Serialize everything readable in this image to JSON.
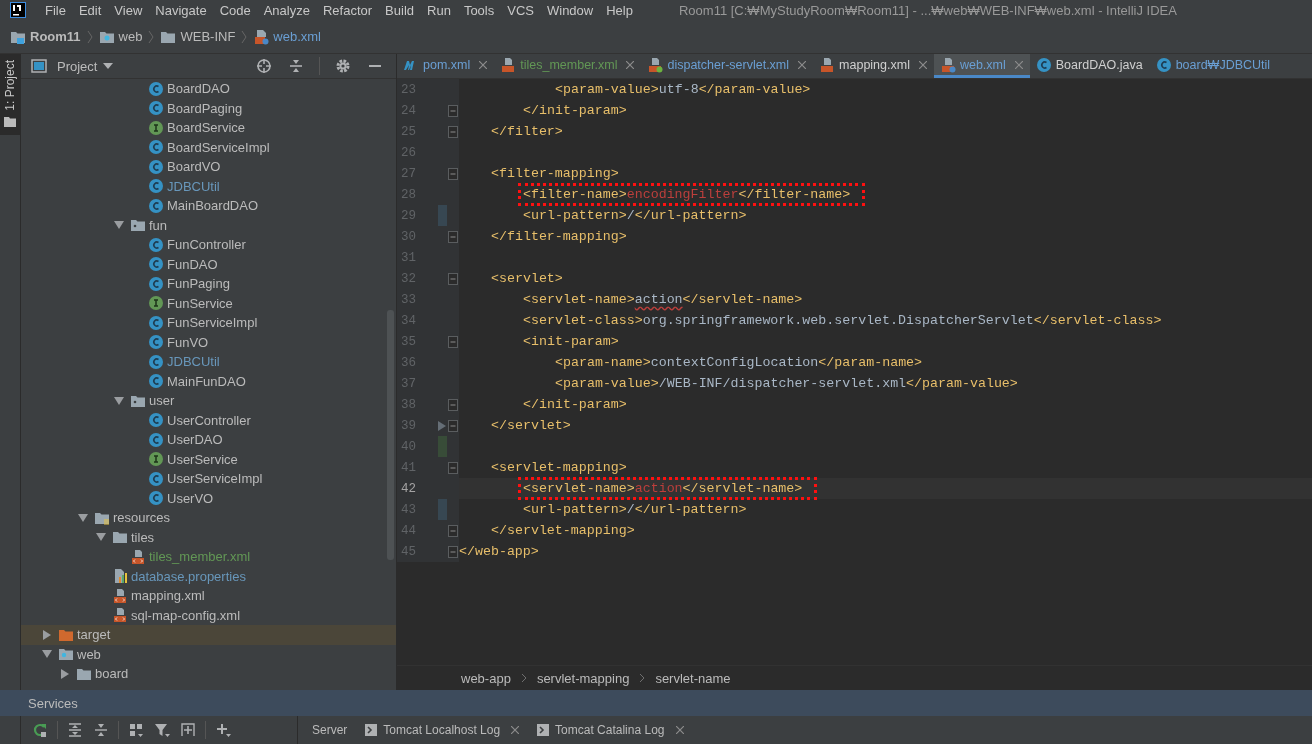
{
  "menu_bar": {
    "items": [
      "File",
      "Edit",
      "View",
      "Navigate",
      "Code",
      "Analyze",
      "Refactor",
      "Build",
      "Run",
      "Tools",
      "VCS",
      "Window",
      "Help"
    ],
    "title": "Room11 [C:₩MyStudyRoom₩Room11] - ...₩web₩WEB-INF₩web.xml - IntelliJ IDEA"
  },
  "navigation_bar": [
    {
      "label": "Room11",
      "kind": "project"
    },
    {
      "label": "web",
      "kind": "web"
    },
    {
      "label": "WEB-INF",
      "kind": "folder"
    },
    {
      "label": "web.xml",
      "kind": "webxml"
    }
  ],
  "tool_stripe": {
    "label": "1: Project",
    "selected": true
  },
  "project_panel": {
    "title": "Project",
    "tree": [
      {
        "children": [
          {
            "children": [
              {
                "children": [
                  {
                    "children": [
                      {
                        "children": [
                          {
                            "label": "BoardDAO",
                            "kind": "class",
                            "color": "#bbbbbb",
                            "selected": false
                          },
                          {
                            "label": "BoardPaging",
                            "kind": "class",
                            "color": "#bbbbbb",
                            "selected": false
                          },
                          {
                            "label": "BoardService",
                            "kind": "interface",
                            "color": "#bbbbbb",
                            "selected": false
                          },
                          {
                            "label": "BoardServiceImpl",
                            "kind": "class",
                            "color": "#bbbbbb",
                            "selected": false
                          },
                          {
                            "label": "BoardVO",
                            "kind": "class",
                            "color": "#bbbbbb",
                            "selected": false
                          },
                          {
                            "label": "JDBCUtil",
                            "kind": "class",
                            "color": "#6897bb",
                            "selected": false
                          },
                          {
                            "label": "MainBoardDAO",
                            "kind": "class",
                            "color": "#bbbbbb",
                            "selected": false
                          }
                        ]
                      },
                      {
                        "label": "fun",
                        "kind": "package",
                        "color": "#bbbbbb",
                        "selected": false,
                        "expanded": true,
                        "children": [
                          {
                            "label": "FunController",
                            "kind": "class",
                            "color": "#bbbbbb",
                            "selected": false
                          },
                          {
                            "label": "FunDAO",
                            "kind": "class",
                            "color": "#bbbbbb",
                            "selected": false
                          },
                          {
                            "label": "FunPaging",
                            "kind": "class",
                            "color": "#bbbbbb",
                            "selected": false
                          },
                          {
                            "label": "FunService",
                            "kind": "interface",
                            "color": "#bbbbbb",
                            "selected": false
                          },
                          {
                            "label": "FunServiceImpl",
                            "kind": "class",
                            "color": "#bbbbbb",
                            "selected": false
                          },
                          {
                            "label": "FunVO",
                            "kind": "class",
                            "color": "#bbbbbb",
                            "selected": false
                          },
                          {
                            "label": "JDBCUtil",
                            "kind": "class",
                            "color": "#6897bb",
                            "selected": false
                          },
                          {
                            "label": "MainFunDAO",
                            "kind": "class",
                            "color": "#bbbbbb",
                            "selected": false
                          }
                        ]
                      },
                      {
                        "label": "user",
                        "kind": "package",
                        "color": "#bbbbbb",
                        "selected": false,
                        "expanded": true,
                        "children": [
                          {
                            "label": "UserController",
                            "kind": "class",
                            "color": "#bbbbbb",
                            "selected": false
                          },
                          {
                            "label": "UserDAO",
                            "kind": "class",
                            "color": "#bbbbbb",
                            "selected": false
                          },
                          {
                            "label": "UserService",
                            "kind": "interface",
                            "color": "#bbbbbb",
                            "selected": false
                          },
                          {
                            "label": "UserServiceImpl",
                            "kind": "class",
                            "color": "#bbbbbb",
                            "selected": false
                          },
                          {
                            "label": "UserVO",
                            "kind": "class",
                            "color": "#bbbbbb",
                            "selected": false
                          }
                        ]
                      }
                    ]
                  }
                ]
              },
              {
                "label": "resources",
                "kind": "resources",
                "color": "#bbbbbb",
                "selected": false,
                "expanded": true,
                "children": [
                  {
                    "label": "tiles",
                    "kind": "folder",
                    "color": "#bbbbbb",
                    "selected": false,
                    "expanded": true,
                    "children": [
                      {
                        "label": "tiles_member.xml",
                        "kind": "xml",
                        "color": "#629755",
                        "selected": false
                      }
                    ]
                  },
                  {
                    "label": "database.properties",
                    "kind": "properties",
                    "color": "#6897bb",
                    "selected": false
                  },
                  {
                    "label": "mapping.xml",
                    "kind": "xml",
                    "color": "#bbbbbb",
                    "selected": false
                  },
                  {
                    "label": "sql-map-config.xml",
                    "kind": "xml",
                    "color": "#bbbbbb",
                    "selected": false
                  }
                ]
              }
            ]
          }
        ]
      },
      {
        "label": "target",
        "kind": "excluded",
        "color": "#bbbbbb",
        "selected": true,
        "expanded": false
      },
      {
        "label": "web",
        "kind": "web",
        "color": "#bbbbbb",
        "selected": false,
        "expanded": true,
        "children": [
          {
            "label": "board",
            "kind": "folder",
            "color": "#bbbbbb",
            "selected": false,
            "expanded": false
          }
        ]
      }
    ]
  },
  "editor": {
    "tabs": [
      {
        "label": "pom.xml",
        "kind": "maven",
        "color": "#6a9fd4",
        "selected": false,
        "closable": true
      },
      {
        "label": "tiles_member.xml",
        "kind": "xml",
        "color": "#629755",
        "selected": false,
        "closable": true
      },
      {
        "label": "dispatcher-servlet.xml",
        "kind": "springxml",
        "color": "#6a9fd4",
        "selected": false,
        "closable": true
      },
      {
        "label": "mapping.xml",
        "kind": "xml",
        "color": "#d0d0d0",
        "selected": false,
        "closable": true
      },
      {
        "label": "web.xml",
        "kind": "webxml",
        "color": "#6a9fd4",
        "selected": true,
        "closable": true
      },
      {
        "label": "BoardDAO.java",
        "kind": "class",
        "color": "#d0d0d0",
        "selected": false,
        "closable": false
      },
      {
        "label": "board₩JDBCUtil",
        "kind": "class",
        "color": "#6a9fd4",
        "selected": false,
        "closable": false
      }
    ],
    "lines": [
      {
        "number": "23",
        "tokens": [
          {
            "kind": "open_tag",
            "text": "<param-value>"
          },
          {
            "kind": "text",
            "text": "utf-8"
          },
          {
            "kind": "close_tag",
            "text": "</param-value>"
          }
        ]
      },
      {
        "number": "24",
        "fold": true,
        "tokens": [
          {
            "kind": "close_tag",
            "text": "</init-param>"
          }
        ]
      },
      {
        "number": "25",
        "fold": true,
        "tokens": [
          {
            "kind": "close_tag",
            "text": "</filter>"
          }
        ]
      },
      {
        "number": "26"
      },
      {
        "number": "27",
        "fold": true,
        "tokens": [
          {
            "kind": "open_tag",
            "text": "<filter-mapping>"
          }
        ]
      },
      {
        "number": "28",
        "annotated": true,
        "tokens": [
          {
            "kind": "open_tag",
            "text": "<filter-name>"
          },
          {
            "kind": "error",
            "text": "encodingFilter"
          },
          {
            "kind": "close_tag",
            "text": "</filter-name>"
          }
        ]
      },
      {
        "number": "29",
        "color": "#374752",
        "tokens": [
          {
            "kind": "open_tag",
            "text": "<url-pattern>"
          },
          {
            "kind": "text",
            "text": "/"
          },
          {
            "kind": "close_tag",
            "text": "</url-pattern>"
          }
        ]
      },
      {
        "number": "30",
        "fold": true,
        "tokens": [
          {
            "kind": "close_tag",
            "text": "</filter-mapping>"
          }
        ]
      },
      {
        "number": "31"
      },
      {
        "number": "32",
        "fold": true,
        "tokens": [
          {
            "kind": "open_tag",
            "text": "<servlet>"
          }
        ]
      },
      {
        "number": "33",
        "tokens": [
          {
            "kind": "open_tag",
            "text": "<servlet-name>"
          },
          {
            "kind": "typo",
            "text": "action"
          },
          {
            "kind": "close_tag",
            "text": "</servlet-name>"
          }
        ]
      },
      {
        "number": "34",
        "tokens": [
          {
            "kind": "open_tag",
            "text": "<servlet-class>"
          },
          {
            "kind": "text",
            "text": "org.springframework.web.servlet.DispatcherServlet"
          },
          {
            "kind": "close_tag",
            "text": "</servlet-class>"
          }
        ]
      },
      {
        "number": "35",
        "fold": true,
        "tokens": [
          {
            "kind": "open_tag",
            "text": "<init-param>"
          }
        ]
      },
      {
        "number": "36",
        "tokens": [
          {
            "kind": "open_tag",
            "text": "<param-name>"
          },
          {
            "kind": "text",
            "text": "contextConfigLocation"
          },
          {
            "kind": "close_tag",
            "text": "</param-name>"
          }
        ]
      },
      {
        "number": "37",
        "tokens": [
          {
            "kind": "open_tag",
            "text": "<param-value>"
          },
          {
            "kind": "text",
            "text": "/WEB-INF/dispatcher-servlet.xml"
          },
          {
            "kind": "close_tag",
            "text": "</param-value>"
          }
        ]
      },
      {
        "number": "38",
        "fold": true,
        "tokens": [
          {
            "kind": "close_tag",
            "text": "</init-param>"
          }
        ]
      },
      {
        "number": "39",
        "fold": true,
        "deleted_marker": true,
        "tokens": [
          {
            "kind": "close_tag",
            "text": "</servlet>"
          }
        ]
      },
      {
        "number": "40",
        "color": "#384c38"
      },
      {
        "number": "41",
        "fold": true,
        "tokens": [
          {
            "kind": "open_tag",
            "text": "<servlet-mapping>"
          }
        ]
      },
      {
        "number": "42",
        "current": true,
        "annotated": true,
        "tokens": [
          {
            "kind": "open_tag",
            "text": "<servlet-name>"
          },
          {
            "kind": "error",
            "text": "action"
          },
          {
            "kind": "close_tag",
            "text": "</servlet-name>"
          }
        ]
      },
      {
        "number": "43",
        "color": "#374752",
        "tokens": [
          {
            "kind": "open_tag",
            "text": "<url-pattern>"
          },
          {
            "kind": "text",
            "text": "/"
          },
          {
            "kind": "close_tag",
            "text": "</url-pattern>"
          }
        ]
      },
      {
        "number": "44",
        "fold": true,
        "tokens": [
          {
            "kind": "close_tag",
            "text": "</servlet-mapping>"
          }
        ]
      },
      {
        "number": "45",
        "fold": true,
        "tokens": [
          {
            "kind": "close_tag",
            "text": "</web-app>"
          }
        ]
      }
    ],
    "breadcrumbs": [
      "web-app",
      "servlet-mapping",
      "servlet-name"
    ]
  },
  "services": {
    "title": "Services",
    "tabs": [
      {
        "label": "Server",
        "icon": false,
        "closable": false
      },
      {
        "label": "Tomcat Localhost Log",
        "icon": true,
        "closable": true
      },
      {
        "label": "Tomcat Catalina Log",
        "icon": true,
        "closable": true
      }
    ]
  }
}
